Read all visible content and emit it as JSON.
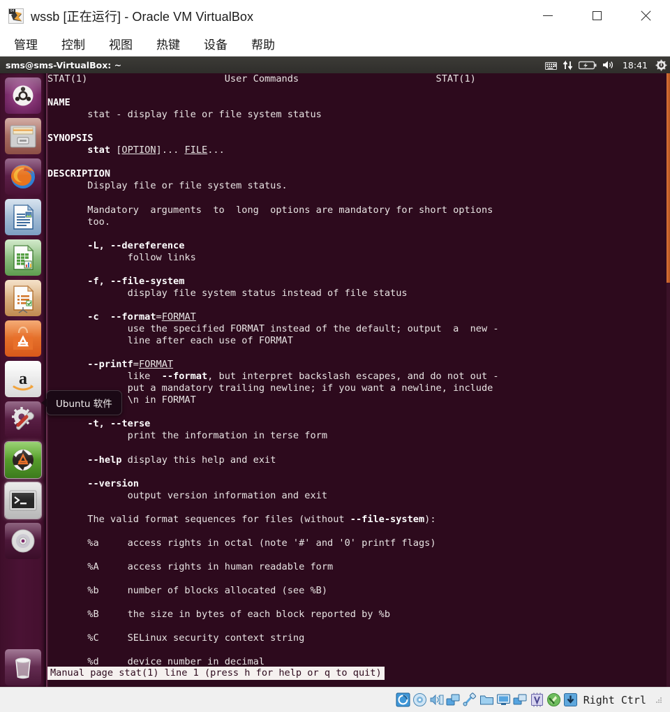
{
  "window": {
    "title": "wssb [正在运行] - Oracle VM VirtualBox",
    "icon_name": "virtualbox-vm-icon",
    "badge": "64",
    "controls": {
      "minimize": "minimize-button",
      "maximize": "maximize-button",
      "close": "close-button"
    }
  },
  "menubar": {
    "items": [
      {
        "label": "管理"
      },
      {
        "label": "控制"
      },
      {
        "label": "视图"
      },
      {
        "label": "热键"
      },
      {
        "label": "设备"
      },
      {
        "label": "帮助"
      }
    ]
  },
  "guest": {
    "panel": {
      "title": "sms@sms-VirtualBox: ~",
      "clock": "18:41",
      "indicators": [
        {
          "name": "keyboard-indicator-icon"
        },
        {
          "name": "network-indicator-icon"
        },
        {
          "name": "battery-indicator-icon"
        },
        {
          "name": "volume-indicator-icon"
        },
        {
          "name": "clock-indicator"
        },
        {
          "name": "session-gear-icon"
        }
      ]
    },
    "launcher": {
      "items": [
        {
          "name": "ubuntu-dash-icon",
          "label": "Dash 主页"
        },
        {
          "name": "files-nautilus-icon",
          "label": "文件"
        },
        {
          "name": "firefox-icon",
          "label": "Firefox 浏览器"
        },
        {
          "name": "libreoffice-writer-icon",
          "label": "LibreOffice Writer"
        },
        {
          "name": "libreoffice-calc-icon",
          "label": "LibreOffice Calc"
        },
        {
          "name": "libreoffice-impress-icon",
          "label": "LibreOffice Impress"
        },
        {
          "name": "ubuntu-software-icon",
          "label": "Ubuntu 软件"
        },
        {
          "name": "amazon-icon",
          "label": "Amazon"
        },
        {
          "name": "system-settings-icon",
          "label": "系统设置"
        },
        {
          "name": "software-updater-icon",
          "label": "软件更新器"
        },
        {
          "name": "terminal-icon",
          "label": "终端"
        },
        {
          "name": "disc-image-icon",
          "label": "光盘映像"
        },
        {
          "name": "trash-icon",
          "label": "回收站"
        }
      ]
    },
    "tooltip": {
      "text": "Ubuntu 软件"
    },
    "terminal": {
      "man_page": [
        {
          "segments": [
            {
              "t": "STAT(1)                        User Commands                        STAT(1)"
            }
          ]
        },
        {
          "segments": [
            {
              "t": ""
            }
          ]
        },
        {
          "segments": [
            {
              "t": "NAME",
              "b": true
            }
          ]
        },
        {
          "segments": [
            {
              "t": "       stat - display file or file system status"
            }
          ]
        },
        {
          "segments": [
            {
              "t": ""
            }
          ]
        },
        {
          "segments": [
            {
              "t": "SYNOPSIS",
              "b": true
            }
          ]
        },
        {
          "segments": [
            {
              "t": "       "
            },
            {
              "t": "stat",
              "b": true
            },
            {
              "t": " ["
            },
            {
              "t": "OPTION",
              "u": true
            },
            {
              "t": "]... "
            },
            {
              "t": "FILE",
              "u": true
            },
            {
              "t": "..."
            }
          ]
        },
        {
          "segments": [
            {
              "t": ""
            }
          ]
        },
        {
          "segments": [
            {
              "t": "DESCRIPTION",
              "b": true
            }
          ]
        },
        {
          "segments": [
            {
              "t": "       Display file or file system status."
            }
          ]
        },
        {
          "segments": [
            {
              "t": ""
            }
          ]
        },
        {
          "segments": [
            {
              "t": "       Mandatory  arguments  to  long  options are mandatory for short options"
            }
          ]
        },
        {
          "segments": [
            {
              "t": "       too."
            }
          ]
        },
        {
          "segments": [
            {
              "t": ""
            }
          ]
        },
        {
          "segments": [
            {
              "t": "       "
            },
            {
              "t": "-L, --dereference",
              "b": true
            }
          ]
        },
        {
          "segments": [
            {
              "t": "              follow links"
            }
          ]
        },
        {
          "segments": [
            {
              "t": ""
            }
          ]
        },
        {
          "segments": [
            {
              "t": "       "
            },
            {
              "t": "-f, --file-system",
              "b": true
            }
          ]
        },
        {
          "segments": [
            {
              "t": "              display file system status instead of file status"
            }
          ]
        },
        {
          "segments": [
            {
              "t": ""
            }
          ]
        },
        {
          "segments": [
            {
              "t": "       "
            },
            {
              "t": "-c  --format",
              "b": true
            },
            {
              "t": "="
            },
            {
              "t": "FORMAT",
              "u": true
            }
          ]
        },
        {
          "segments": [
            {
              "t": "              use the specified FORMAT instead of the default; output  a  new -"
            }
          ]
        },
        {
          "segments": [
            {
              "t": "              line after each use of FORMAT"
            }
          ]
        },
        {
          "segments": [
            {
              "t": ""
            }
          ]
        },
        {
          "segments": [
            {
              "t": "       "
            },
            {
              "t": "--printf",
              "b": true
            },
            {
              "t": "="
            },
            {
              "t": "FORMAT",
              "u": true
            }
          ]
        },
        {
          "segments": [
            {
              "t": "              like  "
            },
            {
              "t": "--format",
              "b": true
            },
            {
              "t": ", but interpret backslash escapes, and do not out -"
            }
          ]
        },
        {
          "segments": [
            {
              "t": "              put a mandatory trailing newline; if you want a newline, include"
            }
          ]
        },
        {
          "segments": [
            {
              "t": "              \\n in FORMAT"
            }
          ]
        },
        {
          "segments": [
            {
              "t": ""
            }
          ]
        },
        {
          "segments": [
            {
              "t": "       "
            },
            {
              "t": "-t, --terse",
              "b": true
            }
          ]
        },
        {
          "segments": [
            {
              "t": "              print the information in terse form"
            }
          ]
        },
        {
          "segments": [
            {
              "t": ""
            }
          ]
        },
        {
          "segments": [
            {
              "t": "       "
            },
            {
              "t": "--help",
              "b": true
            },
            {
              "t": " display this help and exit"
            }
          ]
        },
        {
          "segments": [
            {
              "t": ""
            }
          ]
        },
        {
          "segments": [
            {
              "t": "       "
            },
            {
              "t": "--version",
              "b": true
            }
          ]
        },
        {
          "segments": [
            {
              "t": "              output version information and exit"
            }
          ]
        },
        {
          "segments": [
            {
              "t": ""
            }
          ]
        },
        {
          "segments": [
            {
              "t": "       The valid format sequences for files (without "
            },
            {
              "t": "--file-system",
              "b": true
            },
            {
              "t": "):"
            }
          ]
        },
        {
          "segments": [
            {
              "t": ""
            }
          ]
        },
        {
          "segments": [
            {
              "t": "       %a     access rights in octal (note '#' and '0' printf flags)"
            }
          ]
        },
        {
          "segments": [
            {
              "t": ""
            }
          ]
        },
        {
          "segments": [
            {
              "t": "       %A     access rights in human readable form"
            }
          ]
        },
        {
          "segments": [
            {
              "t": ""
            }
          ]
        },
        {
          "segments": [
            {
              "t": "       %b     number of blocks allocated (see %B)"
            }
          ]
        },
        {
          "segments": [
            {
              "t": ""
            }
          ]
        },
        {
          "segments": [
            {
              "t": "       %B     the size in bytes of each block reported by %b"
            }
          ]
        },
        {
          "segments": [
            {
              "t": ""
            }
          ]
        },
        {
          "segments": [
            {
              "t": "       %C     SELinux security context string"
            }
          ]
        },
        {
          "segments": [
            {
              "t": ""
            }
          ]
        },
        {
          "segments": [
            {
              "t": "       %d     device number in decimal"
            }
          ]
        }
      ],
      "status_line": "Manual page stat(1) line 1 (press h for help or q to quit)"
    }
  },
  "statusbar": {
    "icons": [
      {
        "name": "hard-disk-icon"
      },
      {
        "name": "optical-drive-icon"
      },
      {
        "name": "audio-icon"
      },
      {
        "name": "network-icon"
      },
      {
        "name": "usb-icon"
      },
      {
        "name": "shared-folders-icon"
      },
      {
        "name": "display-icon"
      },
      {
        "name": "recording-icon"
      },
      {
        "name": "virtualization-icon"
      },
      {
        "name": "mouse-integration-icon"
      },
      {
        "name": "host-key-icon"
      }
    ],
    "host_key": "Right Ctrl",
    "grip": "resize-grip"
  },
  "colors": {
    "terminal_bg": "#2d0a1d",
    "launcher_bg": "#4a1234",
    "panel_bg": "#332f2c",
    "accent_orange": "#d8743a",
    "status_bg": "#f0f0f0"
  }
}
